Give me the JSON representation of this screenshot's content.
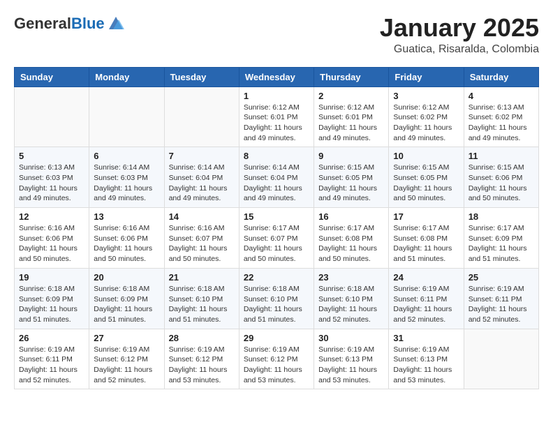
{
  "header": {
    "logo_line1": "General",
    "logo_line2": "Blue",
    "month": "January 2025",
    "location": "Guatica, Risaralda, Colombia"
  },
  "weekdays": [
    "Sunday",
    "Monday",
    "Tuesday",
    "Wednesday",
    "Thursday",
    "Friday",
    "Saturday"
  ],
  "weeks": [
    [
      {
        "day": "",
        "info": ""
      },
      {
        "day": "",
        "info": ""
      },
      {
        "day": "",
        "info": ""
      },
      {
        "day": "1",
        "info": "Sunrise: 6:12 AM\nSunset: 6:01 PM\nDaylight: 11 hours\nand 49 minutes."
      },
      {
        "day": "2",
        "info": "Sunrise: 6:12 AM\nSunset: 6:01 PM\nDaylight: 11 hours\nand 49 minutes."
      },
      {
        "day": "3",
        "info": "Sunrise: 6:12 AM\nSunset: 6:02 PM\nDaylight: 11 hours\nand 49 minutes."
      },
      {
        "day": "4",
        "info": "Sunrise: 6:13 AM\nSunset: 6:02 PM\nDaylight: 11 hours\nand 49 minutes."
      }
    ],
    [
      {
        "day": "5",
        "info": "Sunrise: 6:13 AM\nSunset: 6:03 PM\nDaylight: 11 hours\nand 49 minutes."
      },
      {
        "day": "6",
        "info": "Sunrise: 6:14 AM\nSunset: 6:03 PM\nDaylight: 11 hours\nand 49 minutes."
      },
      {
        "day": "7",
        "info": "Sunrise: 6:14 AM\nSunset: 6:04 PM\nDaylight: 11 hours\nand 49 minutes."
      },
      {
        "day": "8",
        "info": "Sunrise: 6:14 AM\nSunset: 6:04 PM\nDaylight: 11 hours\nand 49 minutes."
      },
      {
        "day": "9",
        "info": "Sunrise: 6:15 AM\nSunset: 6:05 PM\nDaylight: 11 hours\nand 49 minutes."
      },
      {
        "day": "10",
        "info": "Sunrise: 6:15 AM\nSunset: 6:05 PM\nDaylight: 11 hours\nand 50 minutes."
      },
      {
        "day": "11",
        "info": "Sunrise: 6:15 AM\nSunset: 6:06 PM\nDaylight: 11 hours\nand 50 minutes."
      }
    ],
    [
      {
        "day": "12",
        "info": "Sunrise: 6:16 AM\nSunset: 6:06 PM\nDaylight: 11 hours\nand 50 minutes."
      },
      {
        "day": "13",
        "info": "Sunrise: 6:16 AM\nSunset: 6:06 PM\nDaylight: 11 hours\nand 50 minutes."
      },
      {
        "day": "14",
        "info": "Sunrise: 6:16 AM\nSunset: 6:07 PM\nDaylight: 11 hours\nand 50 minutes."
      },
      {
        "day": "15",
        "info": "Sunrise: 6:17 AM\nSunset: 6:07 PM\nDaylight: 11 hours\nand 50 minutes."
      },
      {
        "day": "16",
        "info": "Sunrise: 6:17 AM\nSunset: 6:08 PM\nDaylight: 11 hours\nand 50 minutes."
      },
      {
        "day": "17",
        "info": "Sunrise: 6:17 AM\nSunset: 6:08 PM\nDaylight: 11 hours\nand 51 minutes."
      },
      {
        "day": "18",
        "info": "Sunrise: 6:17 AM\nSunset: 6:09 PM\nDaylight: 11 hours\nand 51 minutes."
      }
    ],
    [
      {
        "day": "19",
        "info": "Sunrise: 6:18 AM\nSunset: 6:09 PM\nDaylight: 11 hours\nand 51 minutes."
      },
      {
        "day": "20",
        "info": "Sunrise: 6:18 AM\nSunset: 6:09 PM\nDaylight: 11 hours\nand 51 minutes."
      },
      {
        "day": "21",
        "info": "Sunrise: 6:18 AM\nSunset: 6:10 PM\nDaylight: 11 hours\nand 51 minutes."
      },
      {
        "day": "22",
        "info": "Sunrise: 6:18 AM\nSunset: 6:10 PM\nDaylight: 11 hours\nand 51 minutes."
      },
      {
        "day": "23",
        "info": "Sunrise: 6:18 AM\nSunset: 6:10 PM\nDaylight: 11 hours\nand 52 minutes."
      },
      {
        "day": "24",
        "info": "Sunrise: 6:19 AM\nSunset: 6:11 PM\nDaylight: 11 hours\nand 52 minutes."
      },
      {
        "day": "25",
        "info": "Sunrise: 6:19 AM\nSunset: 6:11 PM\nDaylight: 11 hours\nand 52 minutes."
      }
    ],
    [
      {
        "day": "26",
        "info": "Sunrise: 6:19 AM\nSunset: 6:11 PM\nDaylight: 11 hours\nand 52 minutes."
      },
      {
        "day": "27",
        "info": "Sunrise: 6:19 AM\nSunset: 6:12 PM\nDaylight: 11 hours\nand 52 minutes."
      },
      {
        "day": "28",
        "info": "Sunrise: 6:19 AM\nSunset: 6:12 PM\nDaylight: 11 hours\nand 53 minutes."
      },
      {
        "day": "29",
        "info": "Sunrise: 6:19 AM\nSunset: 6:12 PM\nDaylight: 11 hours\nand 53 minutes."
      },
      {
        "day": "30",
        "info": "Sunrise: 6:19 AM\nSunset: 6:13 PM\nDaylight: 11 hours\nand 53 minutes."
      },
      {
        "day": "31",
        "info": "Sunrise: 6:19 AM\nSunset: 6:13 PM\nDaylight: 11 hours\nand 53 minutes."
      },
      {
        "day": "",
        "info": ""
      }
    ]
  ]
}
